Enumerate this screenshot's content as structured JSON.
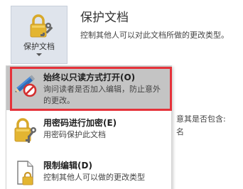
{
  "ribbon": {
    "protect_button_label": "保护文档"
  },
  "panel": {
    "heading": "保护文档",
    "description": "控制其他人可以对此文档所做的更改类型。"
  },
  "behind_menu": {
    "line1": "意其是否包含:",
    "line2": "名"
  },
  "menu": {
    "items": [
      {
        "title": "始终以只读方式打开(O)",
        "subtitle": "询问读者是否加入编辑，防止意外的更改。",
        "icon": "pencil-no-entry-icon"
      },
      {
        "title": "用密码进行加密(E)",
        "subtitle": "用密码保护此文档",
        "icon": "lock-key-icon"
      },
      {
        "title": "限制编辑(D)",
        "subtitle": "控制其他人可以做的更改类型",
        "icon": "document-lock-icon"
      }
    ]
  },
  "colors": {
    "highlight_border": "#e5323a",
    "selected_background": "#c4c4c4",
    "ribbon_button_background": "#dfe4ec",
    "lock_gold": "#e3b531"
  }
}
